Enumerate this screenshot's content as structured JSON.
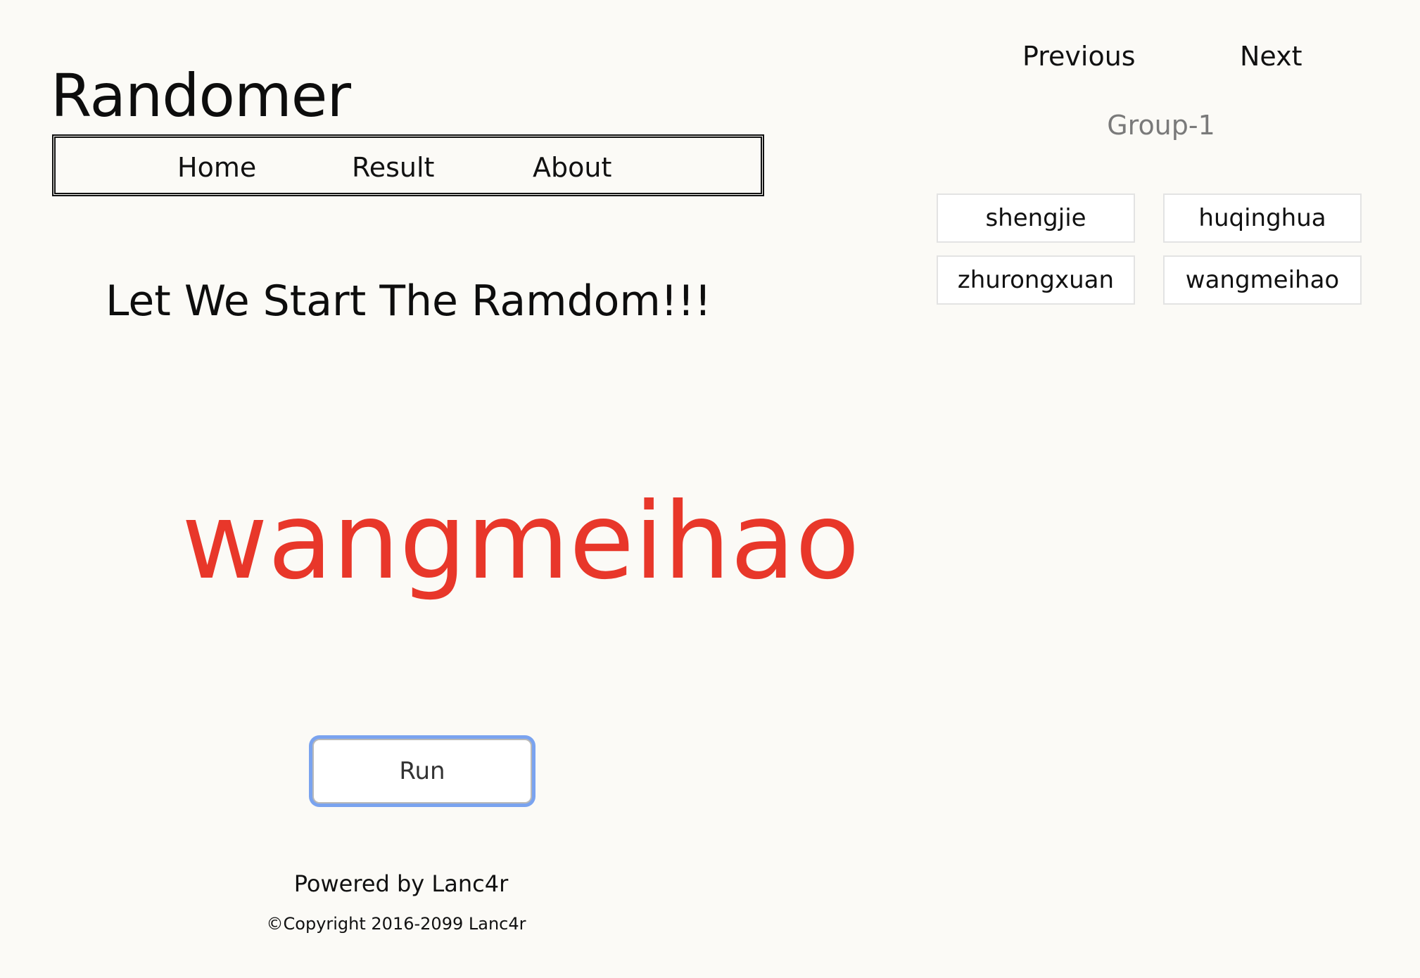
{
  "app": {
    "title": "Randomer"
  },
  "nav": {
    "items": [
      {
        "label": "Home"
      },
      {
        "label": "Result"
      },
      {
        "label": "About"
      }
    ]
  },
  "main": {
    "headline": "Let We Start The Ramdom!!!",
    "result_name": "wangmeihao",
    "run_label": "Run"
  },
  "footer": {
    "powered_by": "Powered by Lanc4r",
    "copyright": "©Copyright 2016-2099 Lanc4r"
  },
  "sidebar": {
    "previous_label": "Previous",
    "next_label": "Next",
    "group_label": "Group-1",
    "members": [
      {
        "name": "shengjie"
      },
      {
        "name": "huqinghua"
      },
      {
        "name": "zhurongxuan"
      },
      {
        "name": "wangmeihao"
      }
    ]
  },
  "colors": {
    "background": "#fbfaf6",
    "result_text": "#e8372a",
    "group_label": "#7a7a7a",
    "run_focus_ring": "#7aa3ef"
  }
}
